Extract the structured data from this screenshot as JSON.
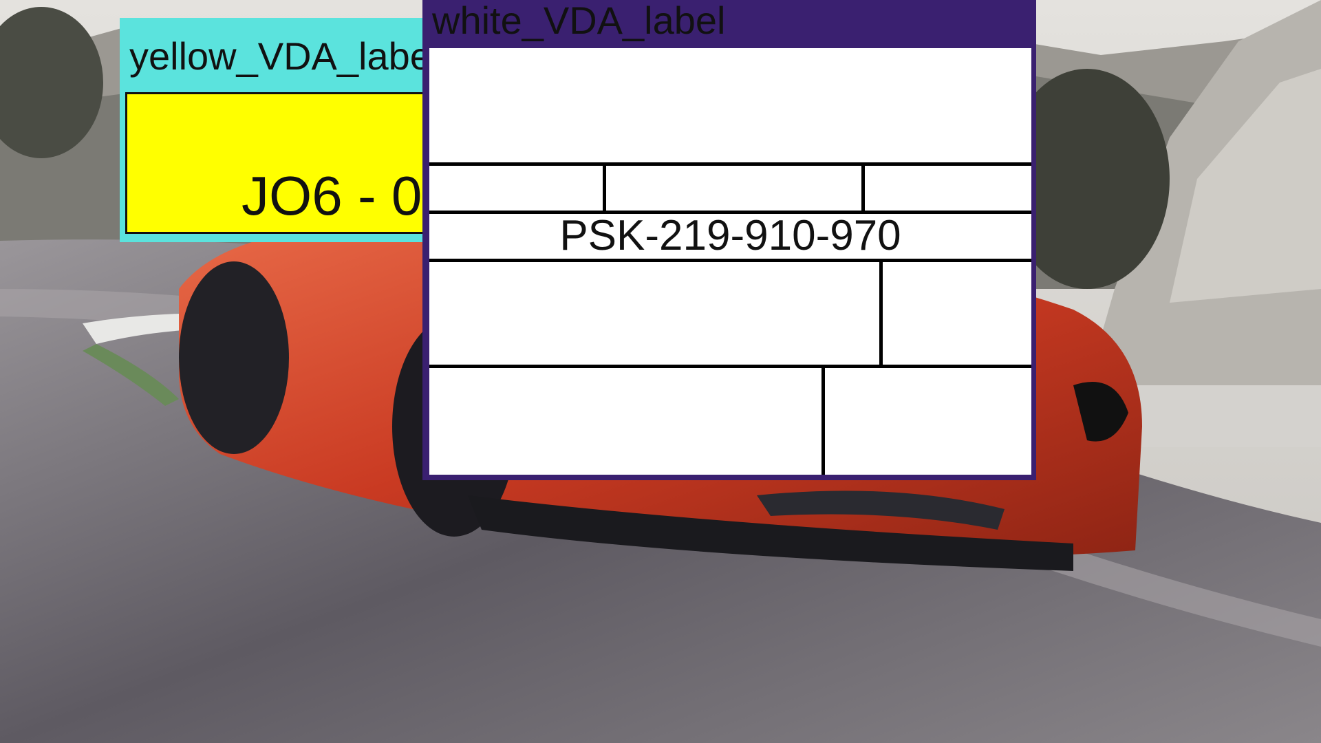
{
  "background": {
    "subject": "car-on-race-track",
    "colors": {
      "sky": "#d8d6d2",
      "track": "#6e6a70",
      "car": "#d84a2e",
      "rock": "#b8b6b2"
    }
  },
  "yellow_label": {
    "title": "yellow_VDA_label",
    "code": "JO6 - 0",
    "colors": {
      "frame": "#5be3dd",
      "body": "#ffff00"
    }
  },
  "white_label": {
    "title": "white_VDA_label",
    "part_number": "PSK-219-910-970",
    "colors": {
      "frame": "#3a2070",
      "body": "#ffffff",
      "grid": "#000000"
    }
  }
}
